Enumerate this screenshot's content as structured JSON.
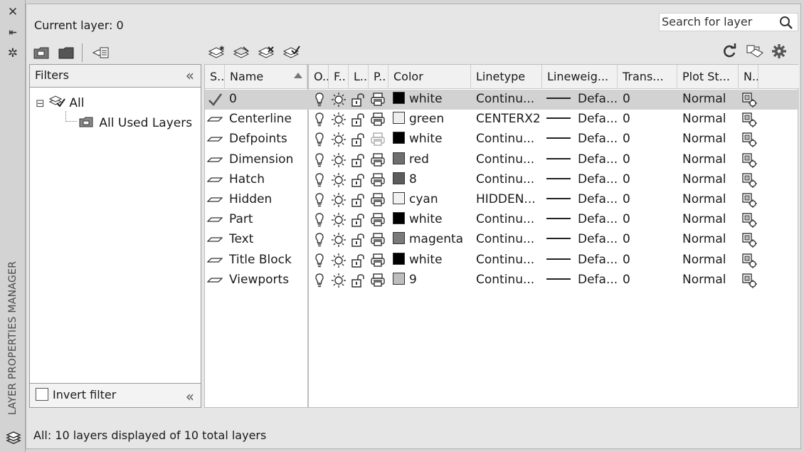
{
  "window": {
    "title_vertical": "LAYER PROPERTIES MANAGER",
    "close_glyph": "✕",
    "autohide_glyph": "⇤",
    "properties_glyph": "✲"
  },
  "header": {
    "current_layer": "Current layer: 0",
    "search_placeholder": "Search for layer"
  },
  "filters": {
    "title": "Filters",
    "collapse_glyph": "«",
    "tree": [
      {
        "label": "All",
        "expander": "⊟"
      },
      {
        "label": "All Used Layers"
      }
    ],
    "invert_label": "Invert filter"
  },
  "grid": {
    "columns": [
      "S..",
      "Name",
      "O..",
      "F..",
      "L..",
      "P..",
      "Color",
      "Linetype",
      "Lineweig...",
      "Trans...",
      "Plot St...",
      "N.."
    ],
    "rows": [
      {
        "name": "0",
        "color_name": "white",
        "swatch": "#000000",
        "linetype": "Continu...",
        "lineweight": "Defa...",
        "trans": "0",
        "plot_style": "Normal",
        "current": true,
        "plot_enabled": true
      },
      {
        "name": "Centerline",
        "color_name": "green",
        "swatch": "#eeeeee",
        "linetype": "CENTERX2",
        "lineweight": "Defa...",
        "trans": "0",
        "plot_style": "Normal",
        "current": false,
        "plot_enabled": true
      },
      {
        "name": "Defpoints",
        "color_name": "white",
        "swatch": "#000000",
        "linetype": "Continu...",
        "lineweight": "Defa...",
        "trans": "0",
        "plot_style": "Normal",
        "current": false,
        "plot_enabled": false
      },
      {
        "name": "Dimension",
        "color_name": "red",
        "swatch": "#6e6e6e",
        "linetype": "Continu...",
        "lineweight": "Defa...",
        "trans": "0",
        "plot_style": "Normal",
        "current": false,
        "plot_enabled": true
      },
      {
        "name": "Hatch",
        "color_name": "8",
        "swatch": "#5c5c5c",
        "linetype": "Continu...",
        "lineweight": "Defa...",
        "trans": "0",
        "plot_style": "Normal",
        "current": false,
        "plot_enabled": true
      },
      {
        "name": "Hidden",
        "color_name": "cyan",
        "swatch": "#f2f2f2",
        "linetype": "HIDDEN...",
        "lineweight": "Defa...",
        "trans": "0",
        "plot_style": "Normal",
        "current": false,
        "plot_enabled": true
      },
      {
        "name": "Part",
        "color_name": "white",
        "swatch": "#000000",
        "linetype": "Continu...",
        "lineweight": "Defa...",
        "trans": "0",
        "plot_style": "Normal",
        "current": false,
        "plot_enabled": true
      },
      {
        "name": "Text",
        "color_name": "magenta",
        "swatch": "#7a7a7a",
        "linetype": "Continu...",
        "lineweight": "Defa...",
        "trans": "0",
        "plot_style": "Normal",
        "current": false,
        "plot_enabled": true
      },
      {
        "name": "Title Block",
        "color_name": "white",
        "swatch": "#000000",
        "linetype": "Continu...",
        "lineweight": "Defa...",
        "trans": "0",
        "plot_style": "Normal",
        "current": false,
        "plot_enabled": true
      },
      {
        "name": "Viewports",
        "color_name": "9",
        "swatch": "#bdbdbd",
        "linetype": "Continu...",
        "lineweight": "Defa...",
        "trans": "0",
        "plot_style": "Normal",
        "current": false,
        "plot_enabled": true
      }
    ]
  },
  "status": "All: 10 layers displayed of 10 total layers"
}
